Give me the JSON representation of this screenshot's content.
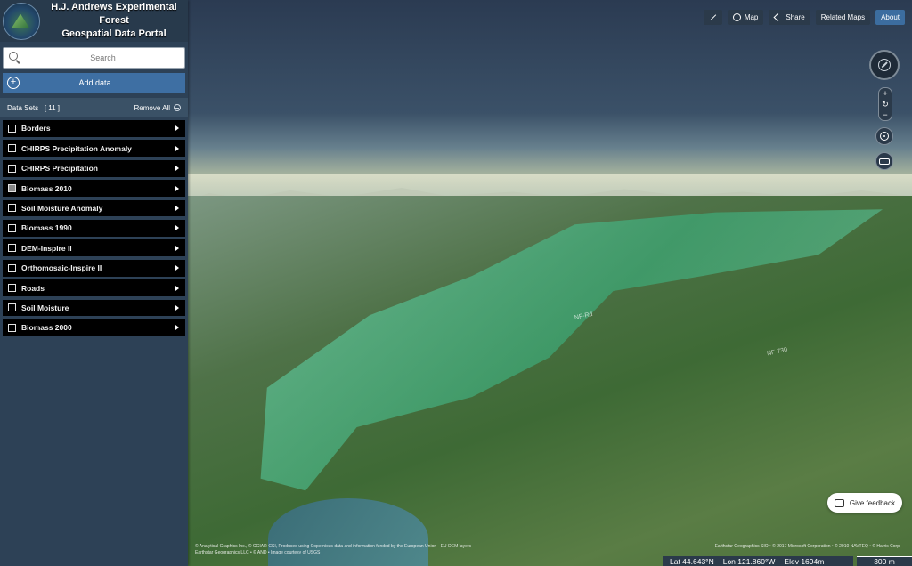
{
  "brand": {
    "title_line1": "H.J. Andrews Experimental Forest",
    "title_line2": "Geospatial Data Portal"
  },
  "search": {
    "placeholder": "Search"
  },
  "add_data": {
    "label": "Add data"
  },
  "datasets": {
    "label": "Data Sets",
    "count": "[ 11 ]",
    "remove_all": "Remove All",
    "items": [
      {
        "label": "Borders",
        "checked": false
      },
      {
        "label": "CHIRPS Precipitation Anomaly",
        "checked": false
      },
      {
        "label": "CHIRPS Precipitation",
        "checked": false
      },
      {
        "label": "Biomass 2010",
        "checked": true
      },
      {
        "label": "Soil Moisture Anomaly",
        "checked": false
      },
      {
        "label": "Biomass 1990",
        "checked": false
      },
      {
        "label": "DEM-Inspire II",
        "checked": false
      },
      {
        "label": "Orthomosaic-Inspire II",
        "checked": false
      },
      {
        "label": "Roads",
        "checked": false
      },
      {
        "label": "Soil Moisture",
        "checked": false
      },
      {
        "label": "Biomass 2000",
        "checked": false
      }
    ]
  },
  "topbar": {
    "map": "Map",
    "share": "Share",
    "related": "Related Maps",
    "about": "About"
  },
  "map_labels": {
    "road1": "NF-Rd",
    "road2": "NF-730"
  },
  "feedback": {
    "label": "Give feedback"
  },
  "attribution": {
    "left_line1": "© Analytical Graphics Inc., © CGIAR-CSI, Produced using Copernicus data and information funded by the European Union - EU-DEM layers",
    "left_line2": "Earthstar Geographics LLC • © AND • Image courtesy of USGS",
    "right": "Earthstar Geographics SIO • © 2017 Microsoft Corporation • © 2010 NAVTEQ • © Harris Corp"
  },
  "status": {
    "lat": "Lat  44.643°N",
    "lon": "Lon  121.860°W",
    "elev": "Elev  1694m",
    "scale": "300 m"
  },
  "icons": [
    "logo",
    "search-icon",
    "plus-circle-icon",
    "remove-circle-icon",
    "checkbox",
    "chevron-right-icon",
    "expand-icon",
    "globe-icon",
    "share-icon",
    "compass-icon",
    "zoom-in-icon",
    "refresh-icon",
    "zoom-out-icon",
    "locate-icon",
    "vr-icon",
    "feedback-icon"
  ]
}
